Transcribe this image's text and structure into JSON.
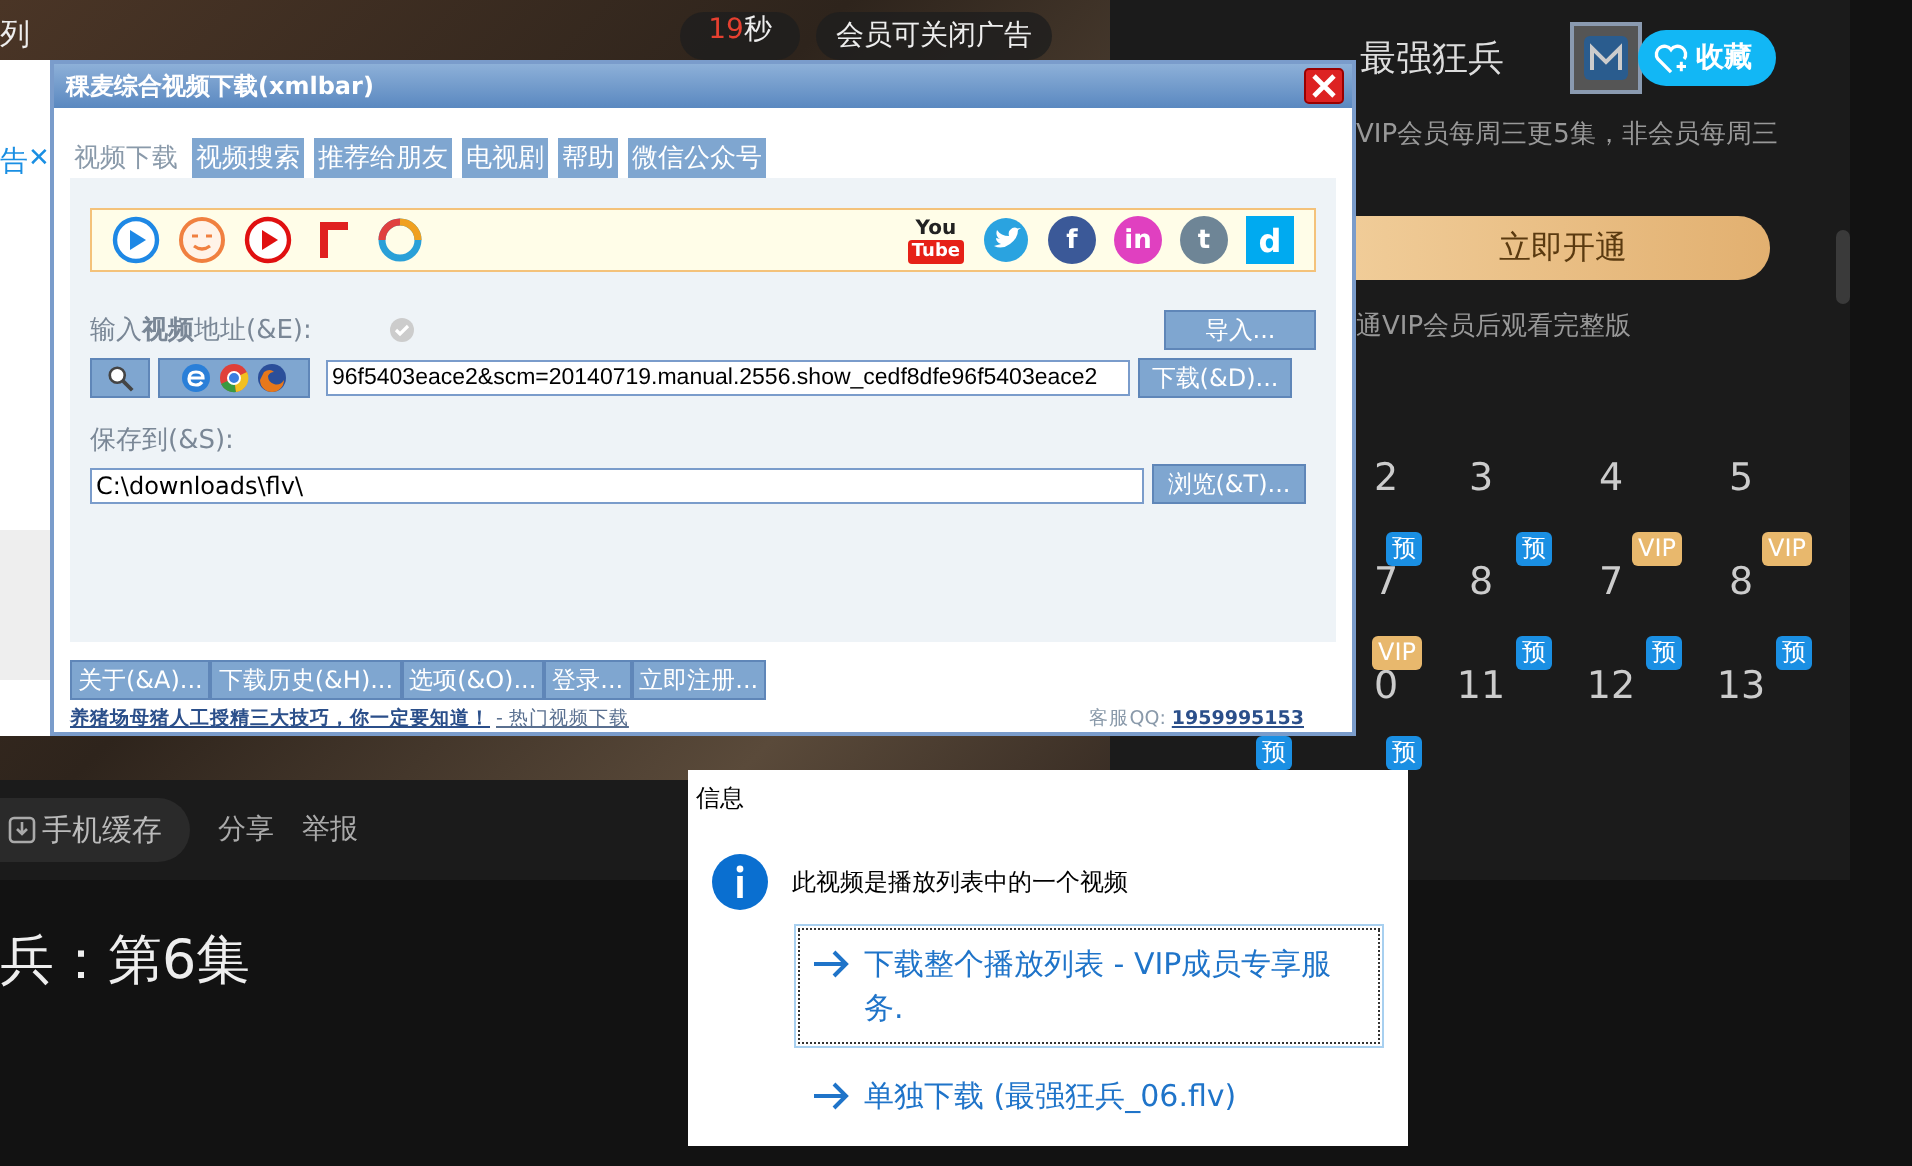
{
  "page": {
    "corner_text": "列",
    "countdown": {
      "number": "19",
      "unit": "秒"
    },
    "ad_close": "会员可关闭广告",
    "left_strip": {
      "text": "告",
      "close": "✕"
    },
    "side_panel": {
      "title": "最强狂兵",
      "favorite": "收藏",
      "description": "VIP会员每周三更5集，非会员每周三",
      "vip_button": "立即开通",
      "vip_note": "通VIP会员后观看完整版",
      "episodes": [
        {
          "number": "2"
        },
        {
          "number": "3"
        },
        {
          "number": "4"
        },
        {
          "number": "5"
        },
        {
          "number": "7",
          "badge": {
            "kind": "preview",
            "text": "预"
          }
        },
        {
          "number": "8",
          "badge": {
            "kind": "preview",
            "text": "预"
          }
        },
        {
          "number": "7",
          "badge": {
            "kind": "vip",
            "text": "VIP"
          }
        },
        {
          "number": "8",
          "badge": {
            "kind": "vip",
            "text": "VIP"
          }
        },
        {
          "number": "0",
          "badge": {
            "kind": "vip",
            "text": "VIP"
          }
        },
        {
          "number": "11",
          "badge": {
            "kind": "preview",
            "text": "预"
          }
        },
        {
          "number": "12",
          "badge": {
            "kind": "preview",
            "text": "预"
          }
        },
        {
          "number": "13",
          "badge": {
            "kind": "preview",
            "text": "预"
          }
        }
      ],
      "next_badges": [
        {
          "kind": "preview",
          "text": "预"
        },
        {
          "kind": "preview",
          "text": "预"
        }
      ]
    },
    "actions": [
      {
        "kind": "cache",
        "label": "手机缓存"
      },
      {
        "kind": "link",
        "label": "分享"
      },
      {
        "kind": "link",
        "label": "举报"
      }
    ],
    "video_title": "兵：第6集"
  },
  "downloader": {
    "title": "稞麦综合视频下载(xmlbar)",
    "tabs": [
      {
        "label": "视频下载",
        "selected": true
      },
      {
        "label": "视频搜索",
        "selected": false
      },
      {
        "label": "推荐给朋友",
        "selected": false
      },
      {
        "label": "电视剧",
        "selected": false
      },
      {
        "label": "帮助",
        "selected": false
      },
      {
        "label": "微信公众号",
        "selected": false
      }
    ],
    "site_icons_left": [
      {
        "kind": "play",
        "color": "#1e88e5"
      },
      {
        "kind": "face",
        "color": "#f08040"
      },
      {
        "kind": "play",
        "color": "#e01010"
      },
      {
        "kind": "bracket",
        "color": "#e02020"
      },
      {
        "kind": "ring",
        "color": "#2aa0d8"
      }
    ],
    "site_icons_right": [
      {
        "kind": "youtube",
        "color": "#e62117",
        "glyph": "You",
        "glyph_bottom": "Tube"
      },
      {
        "kind": "bird",
        "color": "#2aa3e0"
      },
      {
        "kind": "letter",
        "color": "#3b5998",
        "glyph": "f"
      },
      {
        "kind": "letter",
        "color": "#e040c0",
        "glyph": "in"
      },
      {
        "kind": "letter",
        "color": "#6e8596",
        "glyph": "t"
      },
      {
        "kind": "tile",
        "color": "#00aaf0",
        "glyph": "d"
      }
    ],
    "url_label": "输入**视频**地址(&E):",
    "import_button": "导入...",
    "url_value": "96f5403eace2&scm=20140719.manual.2556.show_cedf8dfe96f5403eace2",
    "download_button": "下载(&D)...",
    "save_label": "保存到(&S):",
    "save_path": "C:\\downloads\\flv\\",
    "browse_button": "浏览(&T)...",
    "footer_buttons": [
      "关于(&A)...",
      "下载历史(&H)...",
      "选项(&O)...",
      "登录...",
      "立即注册..."
    ],
    "promo_link": "养猪场母猪人工授精三大技巧，你一定要知道！",
    "promo_suffix": "- 热门视频下载",
    "support_label": "客服QQ:",
    "support_number": "1959995153"
  },
  "dialog": {
    "title": "信息",
    "message": "此视频是播放列表中的一个视频",
    "options": [
      {
        "label": "下载整个播放列表 - VIP成员专享服务.",
        "selected": true
      },
      {
        "label": "单独下载 (最强狂兵_06.flv)",
        "selected": false
      }
    ]
  }
}
